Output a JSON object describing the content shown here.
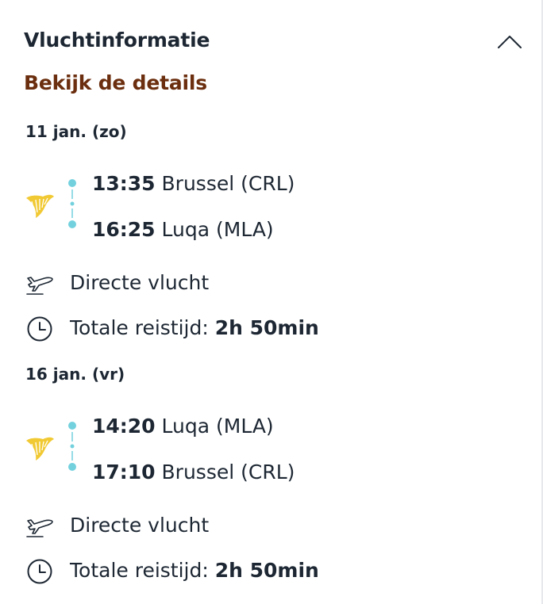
{
  "header": {
    "title": "Vluchtinformatie",
    "toggle_icon": "chevron-up-icon"
  },
  "details_link": "Bekijk de details",
  "colors": {
    "text": "#1d2733",
    "link": "#6b2e0e",
    "timeline_dot": "#73d1de",
    "airline_logo": "#f1c933"
  },
  "legs": [
    {
      "date": "11 jan. (zo)",
      "airline_icon": "ryanair-harp-logo",
      "departure": {
        "time": "13:35",
        "place": "Brussel (CRL)"
      },
      "arrival": {
        "time": "16:25",
        "place": "Luqa (MLA)"
      },
      "flight_type": {
        "icon": "plane-takeoff-icon",
        "label": "Directe vlucht"
      },
      "duration": {
        "icon": "clock-icon",
        "label": "Totale reistijd:",
        "value": "2h 50min"
      }
    },
    {
      "date": "16 jan. (vr)",
      "airline_icon": "ryanair-harp-logo",
      "departure": {
        "time": "14:20",
        "place": "Luqa (MLA)"
      },
      "arrival": {
        "time": "17:10",
        "place": "Brussel (CRL)"
      },
      "flight_type": {
        "icon": "plane-takeoff-icon",
        "label": "Directe vlucht"
      },
      "duration": {
        "icon": "clock-icon",
        "label": "Totale reistijd:",
        "value": "2h 50min"
      }
    }
  ]
}
